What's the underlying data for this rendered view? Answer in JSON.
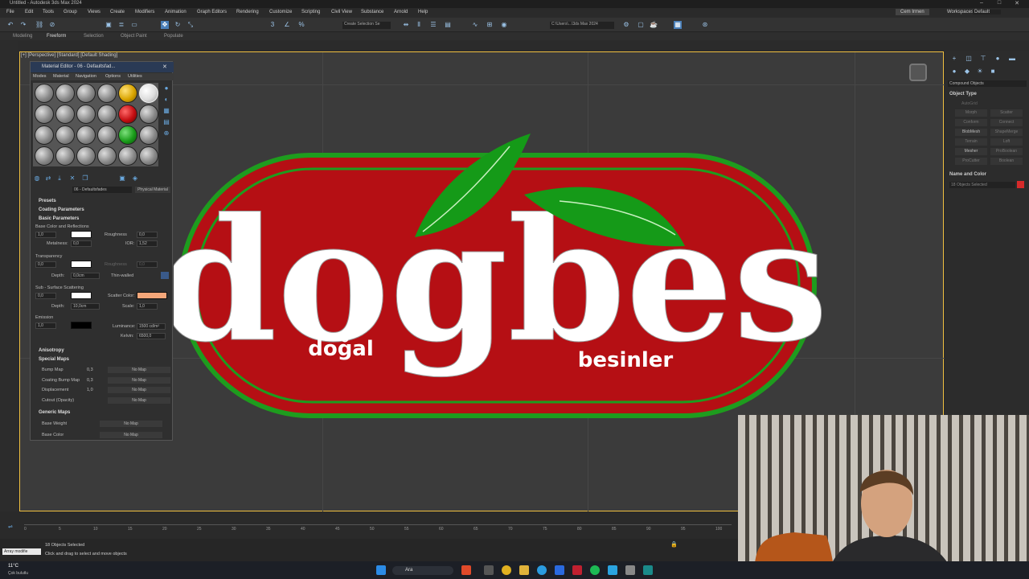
{
  "window": {
    "title": "Untitled - Autodesk 3ds Max 2024"
  },
  "menu": [
    "File",
    "Edit",
    "Tools",
    "Group",
    "Views",
    "Create",
    "Modifiers",
    "Animation",
    "Graph Editors",
    "Rendering",
    "Customize",
    "Scripting",
    "Civil View",
    "Substance",
    "Arnold",
    "Help"
  ],
  "user": "Cem Irmen",
  "workspace": {
    "label": "Workspaces:",
    "value": "Default"
  },
  "toolbar": {
    "selection_set": "Create Selection Se",
    "path": "C:\\Users\\...\\3ds Max 2024"
  },
  "ribbon_tabs": [
    "Modeling",
    "Freeform",
    "Selection",
    "Object Paint",
    "Populate"
  ],
  "viewport": {
    "label": "[+] [Perspective] [Standard] [Default Shading]",
    "logo": {
      "text_main": "dogbes",
      "text_left": "doğal",
      "text_right": "besinler",
      "red": "#b50f14",
      "green": "#1e9c1e"
    }
  },
  "material_editor": {
    "title": "Material Editor - 06 - Defaultsfad...",
    "menu": [
      "Modes",
      "Material",
      "Navigation",
      "Options",
      "Utilities"
    ],
    "material_name": "06 - Defaultsfades",
    "material_type": "Physical Material",
    "sections": {
      "presets": "Presets",
      "coating": "Coating Parameters",
      "basic": "Basic Parameters",
      "anisotropy": "Anisotropy",
      "special_maps": "Special Maps",
      "generic_maps": "Generic Maps"
    },
    "base": {
      "label": "Base Color and Reflections",
      "weight": "1,0",
      "roughness_label": "Roughness",
      "roughness": "0,0",
      "metalness_label": "Metalness:",
      "metalness": "0,0",
      "ior_label": "IOR:",
      "ior": "1,52"
    },
    "transparency": {
      "label": "Transparency",
      "value": "0,0",
      "roughness_label": "Roughness",
      "roughness": "0,0",
      "depth_label": "Depth:",
      "depth": "0,0cm",
      "thin_label": "Thin-walled"
    },
    "sss": {
      "label": "Sub - Surface Scattering",
      "value": "0,0",
      "scatter_label": "Scatter Color:",
      "depth_label": "Depth:",
      "depth": "10,0cm",
      "scale_label": "Scale:",
      "scale": "1,0"
    },
    "emission": {
      "label": "Emission",
      "value": "1,0",
      "lum_label": "Luminance:",
      "lum": "1500 cd/m²",
      "kelvin_label": "Kelvin:",
      "kelvin": "6500,0"
    },
    "special_maps_rows": [
      {
        "label": "Bump Map",
        "val": "0,3",
        "map": "No Map"
      },
      {
        "label": "Coating Bump Map",
        "val": "0,3",
        "map": "No Map"
      },
      {
        "label": "Displacement",
        "val": "1,0",
        "map": "No Map"
      },
      {
        "label": "Cutout (Opacity)",
        "val": "",
        "map": "No Map"
      }
    ],
    "generic_maps_rows": [
      {
        "label": "Base Weight",
        "map": "No Map"
      },
      {
        "label": "Base Color",
        "map": "No Map"
      }
    ]
  },
  "command_panel": {
    "dropdown": "Compound Objects",
    "object_type": "Object Type",
    "autogrid": "AutoGrid",
    "buttons": [
      [
        "Morph",
        "Scatter"
      ],
      [
        "Conform",
        "Connect"
      ],
      [
        "BlobMesh",
        "ShapeMerge"
      ],
      [
        "Terrain",
        "Loft"
      ],
      [
        "Mesher",
        "ProBoolean"
      ],
      [
        "ProCutter",
        "Boolean"
      ]
    ],
    "name_color": "Name and Color",
    "selected": "18 Objects Selected"
  },
  "timeline": {
    "ticks": [
      "0",
      "5",
      "10",
      "15",
      "20",
      "25",
      "30",
      "35",
      "40",
      "45",
      "50",
      "55",
      "60",
      "65",
      "70",
      "75",
      "80",
      "85",
      "90",
      "95",
      "100"
    ]
  },
  "status": {
    "objects": "18 Objects Selected",
    "hint": "Click and drag to select and move objects",
    "script": "Array modifie"
  },
  "taskbar": {
    "weather_temp": "11°C",
    "weather_desc": "Çok bulutlu",
    "search": "Ara"
  }
}
